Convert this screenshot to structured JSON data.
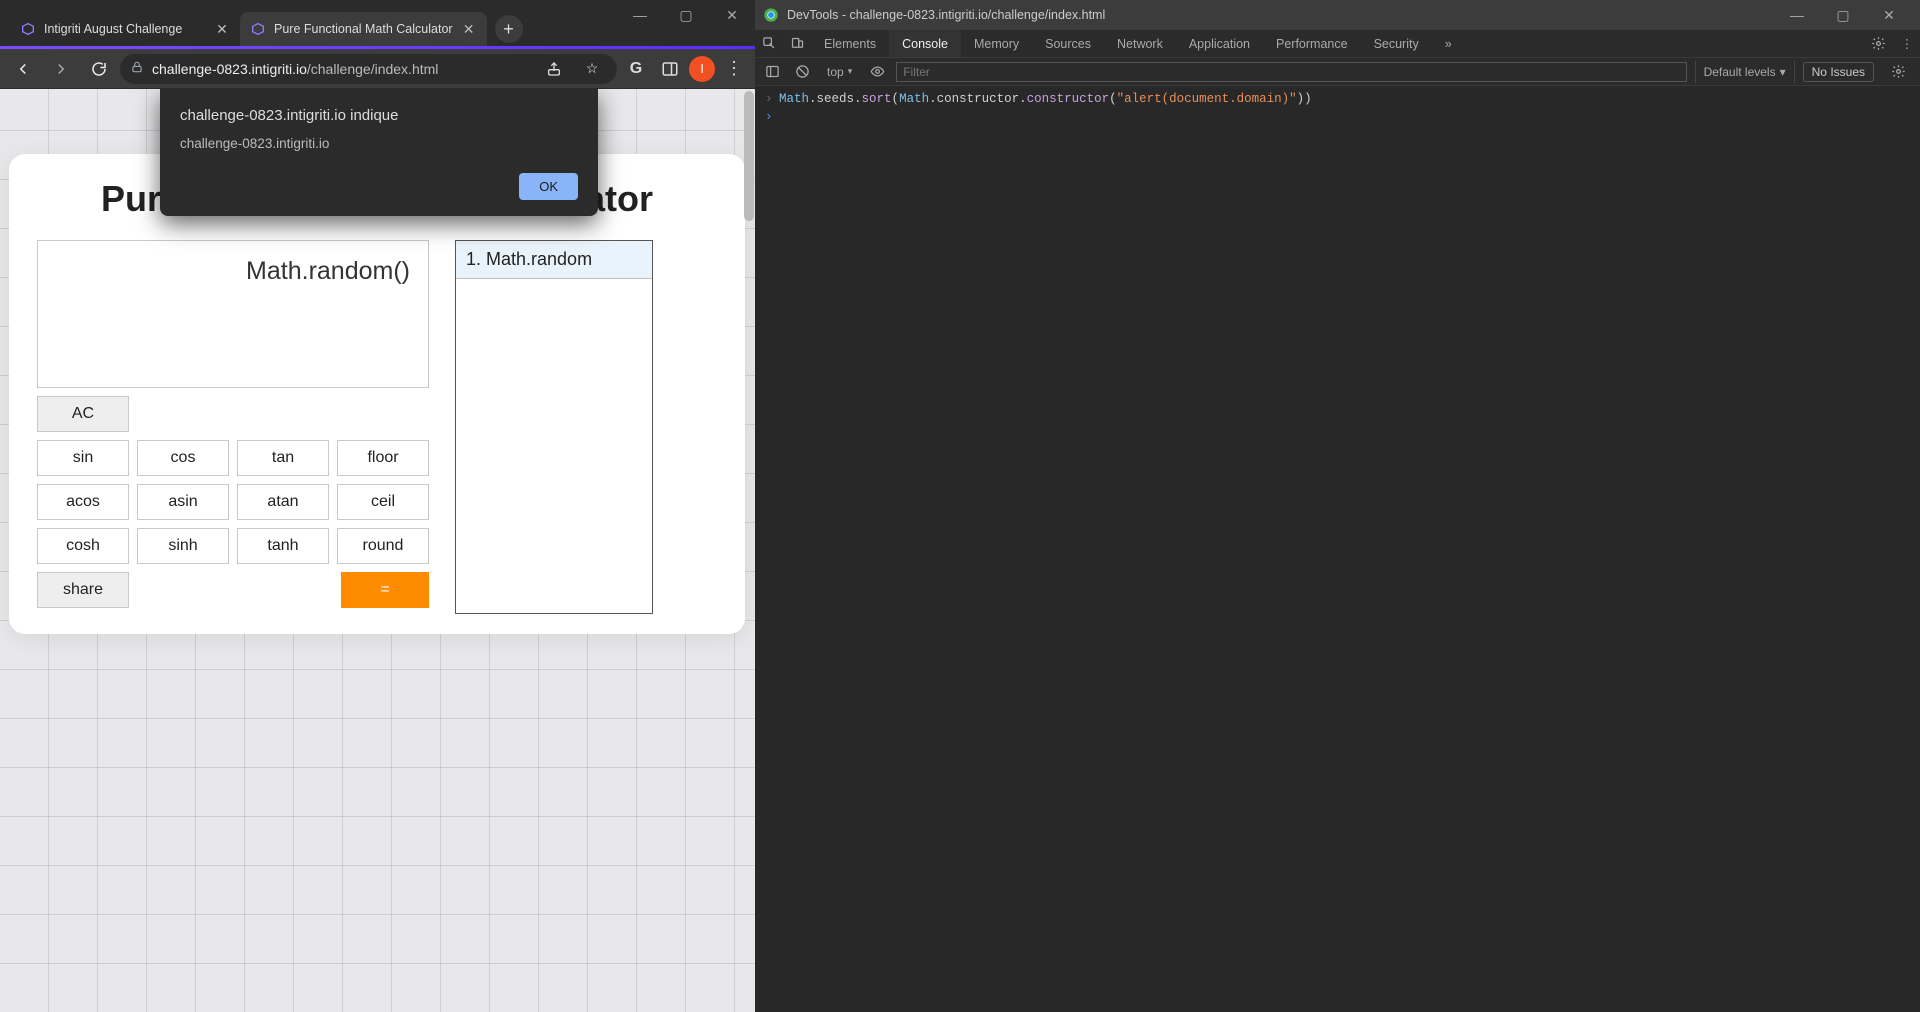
{
  "browser": {
    "tabs": [
      {
        "title": "Intigriti August Challenge",
        "active": false
      },
      {
        "title": "Pure Functional Math Calculator",
        "active": true
      }
    ],
    "newtab_glyph": "+",
    "window_controls": {
      "min": "—",
      "max": "▢",
      "close": "✕"
    },
    "nav": {
      "back": "←",
      "forward": "→",
      "reload": "↻"
    },
    "url": {
      "domain": "challenge-0823.intigriti.io",
      "path": "/challenge/index.html"
    },
    "toolbar_icons": {
      "share": "⇪",
      "star": "☆",
      "g": "G",
      "avatar_letter": "I",
      "kebab": "⋮"
    }
  },
  "page": {
    "title": "Pure Functional Math Calculator",
    "display": "Math.random()",
    "buttons": {
      "ac": "AC",
      "row1": [
        "sin",
        "cos",
        "tan",
        "floor"
      ],
      "row2": [
        "acos",
        "asin",
        "atan",
        "ceil"
      ],
      "row3": [
        "cosh",
        "sinh",
        "tanh",
        "round"
      ],
      "share": "share",
      "equals": "="
    },
    "history": [
      "1. Math.random"
    ]
  },
  "dialog": {
    "origin_line": "challenge-0823.intigriti.io indique",
    "message": "challenge-0823.intigriti.io",
    "ok": "OK"
  },
  "devtools": {
    "title": "DevTools - challenge-0823.intigriti.io/challenge/index.html",
    "tabs": [
      "Elements",
      "Console",
      "Memory",
      "Sources",
      "Network",
      "Application",
      "Performance",
      "Security"
    ],
    "active_tab": "Console",
    "more_glyph": "»",
    "toolbar": {
      "context": "top",
      "filter_placeholder": "Filter",
      "levels": "Default levels",
      "levels_caret": "▾",
      "no_issues": "No Issues"
    },
    "console_code": {
      "seg1": "Math",
      "seg2": ".seeds.",
      "seg3": "sort",
      "seg4": "(",
      "seg5": "Math",
      "seg6": ".constructor.",
      "seg7": "constructor",
      "seg8": "(",
      "seg9": "\"alert(document.domain)\"",
      "seg10": "))"
    }
  }
}
